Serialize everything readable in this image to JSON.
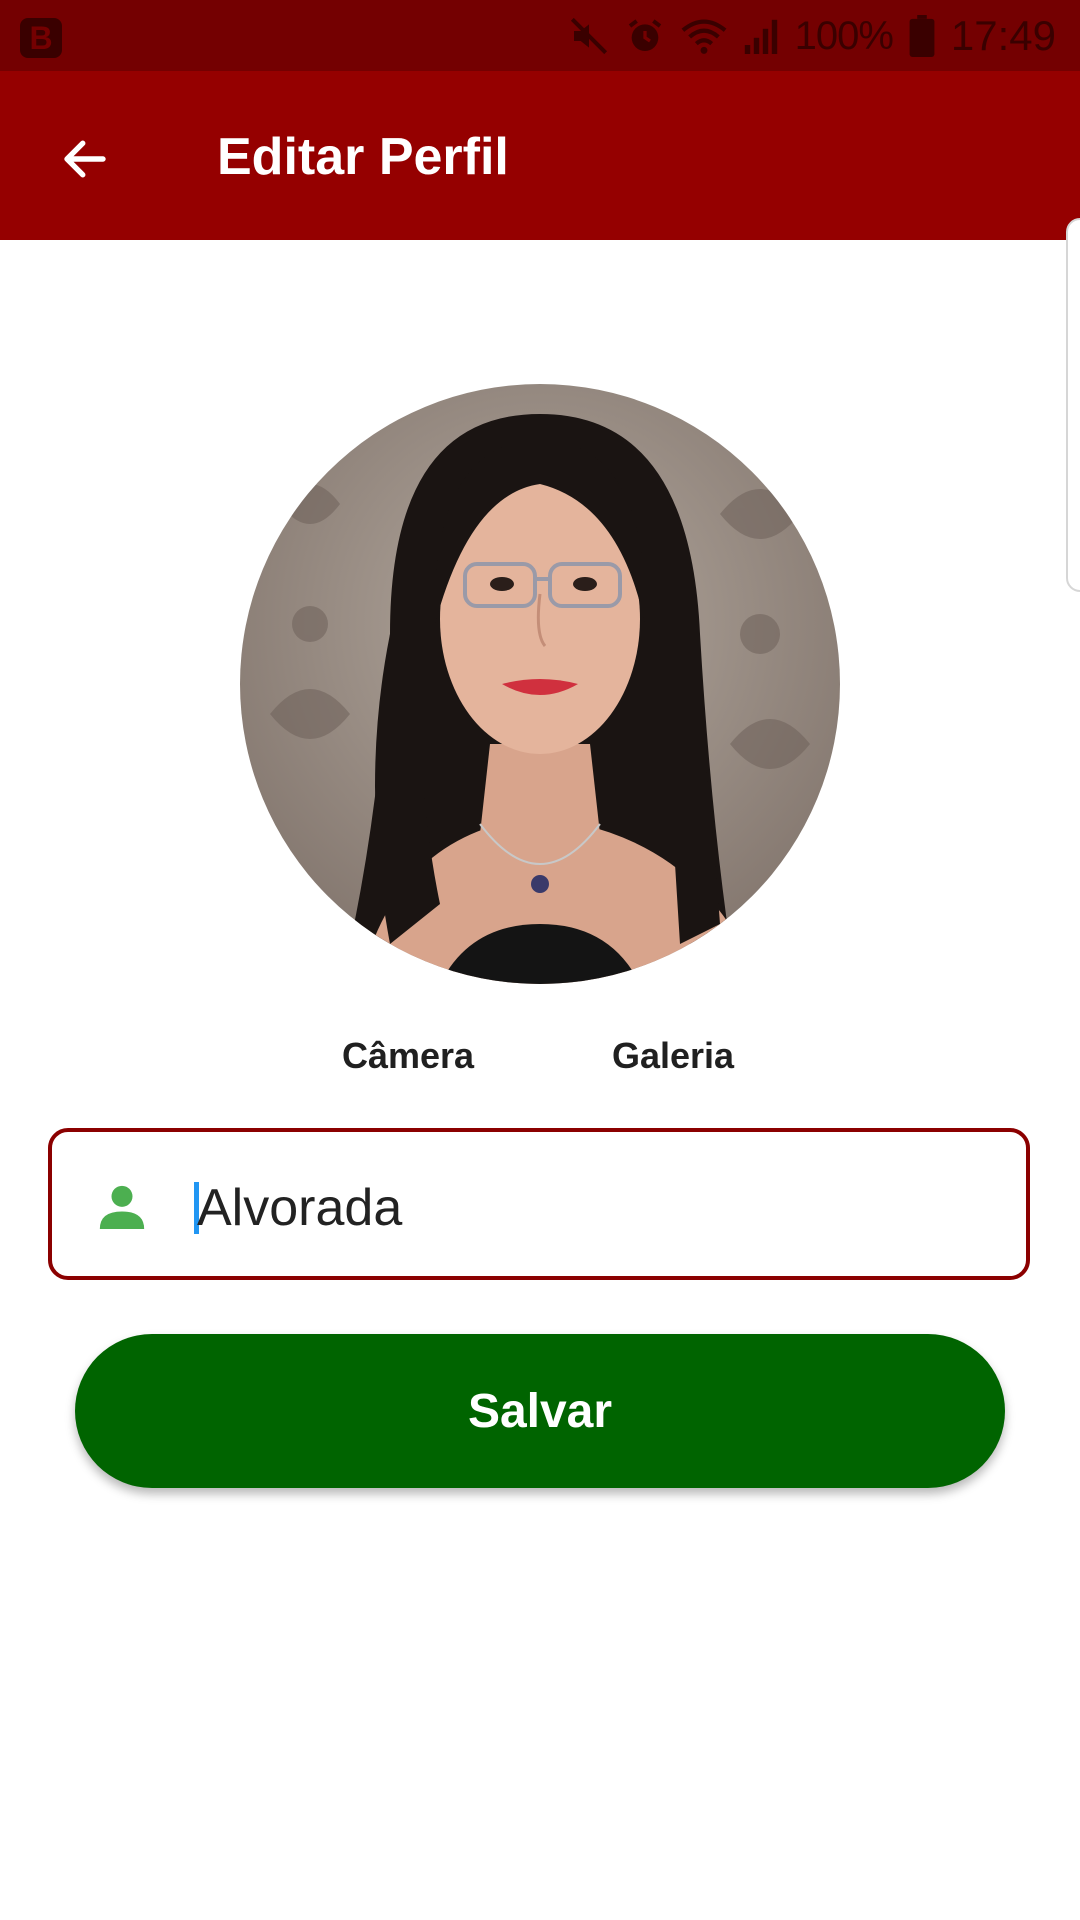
{
  "status_bar": {
    "app_badge": "B",
    "battery": "100%",
    "time": "17:49",
    "icons": [
      "mute-icon",
      "alarm-icon",
      "wifi-icon",
      "signal-icon",
      "battery-icon"
    ]
  },
  "app_bar": {
    "title": "Editar Perfil",
    "back_icon": "arrow-left-icon",
    "background": "#950000"
  },
  "profile": {
    "photo_actions": {
      "camera_label": "Câmera",
      "gallery_label": "Galeria"
    }
  },
  "form": {
    "name_value": "Alvorada",
    "name_icon": "person-icon",
    "field_border": "#8b0000",
    "icon_color": "#4caf50"
  },
  "save": {
    "label": "Salvar",
    "color": "#006400"
  }
}
